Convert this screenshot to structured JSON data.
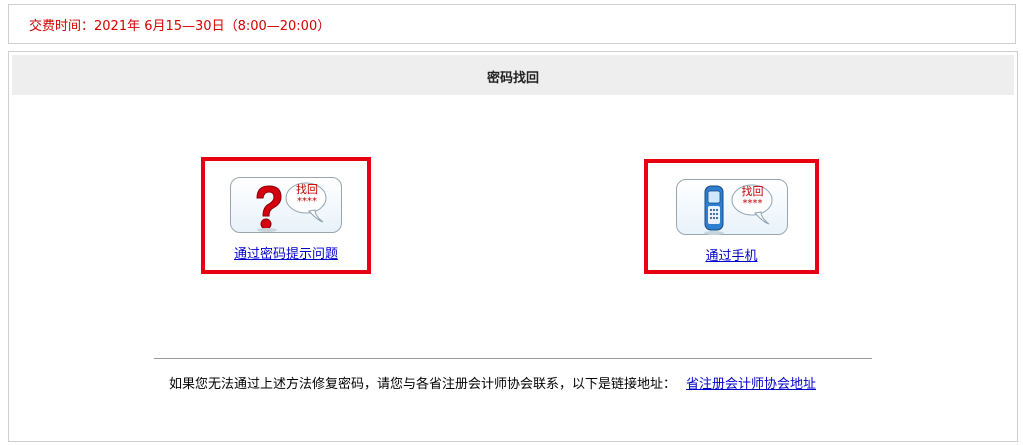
{
  "notice": {
    "text": "交费时间：2021年 6月15—30日（8:00—20:00）"
  },
  "panel": {
    "title": "密码找回"
  },
  "options": [
    {
      "icon": "question-mark-icon",
      "bubble_text": "找回",
      "bubble_stars": "****",
      "link_label": "通过密码提示问题"
    },
    {
      "icon": "mobile-phone-icon",
      "bubble_text": "找回",
      "bubble_stars": "****",
      "link_label": "通过手机"
    }
  ],
  "footer": {
    "text": "如果您无法通过上述方法修复密码，请您与各省注册会计师协会联系，以下是链接地址：",
    "link_label": "省注册会计师协会地址"
  },
  "colors": {
    "notice": "#d40000",
    "highlight_border": "#e60012",
    "link": "#0000cc"
  }
}
